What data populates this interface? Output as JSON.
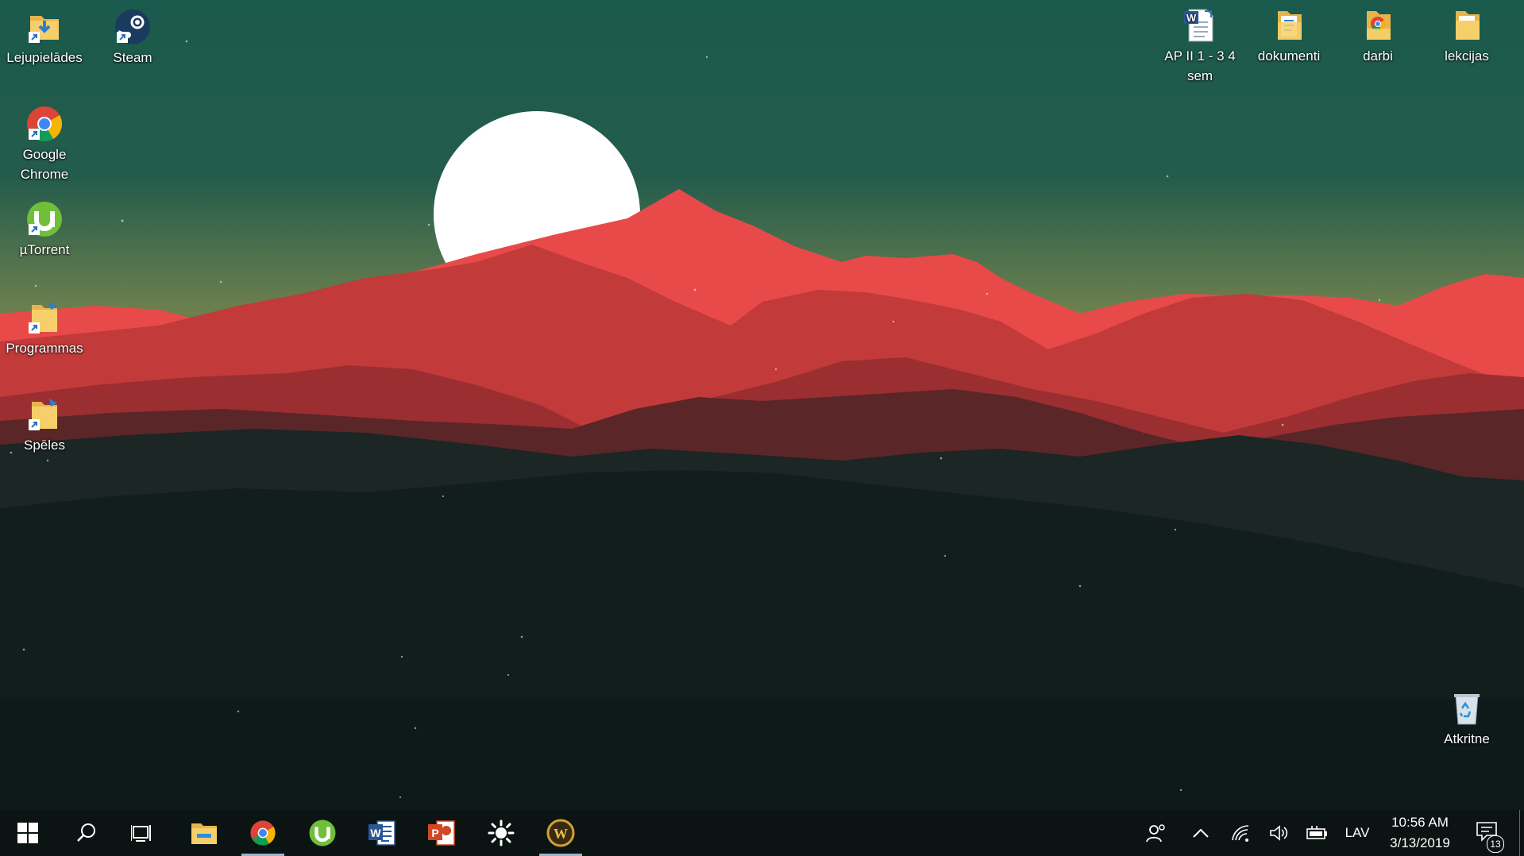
{
  "desktop": {
    "left_icons": [
      {
        "name": "Lejupielādes",
        "icon": "downloads-folder-icon"
      },
      {
        "name": "Steam",
        "icon": "steam-icon"
      },
      {
        "name": "Google Chrome",
        "icon": "chrome-icon"
      },
      {
        "name": "µTorrent",
        "icon": "utorrent-icon"
      },
      {
        "name": "Programmas",
        "icon": "folder-shortcut-icon"
      },
      {
        "name": "Spēles",
        "icon": "folder-shortcut-icon"
      }
    ],
    "right_icons": [
      {
        "name": "AP II 1 - 3  4 sem",
        "icon": "word-document-icon"
      },
      {
        "name": "dokumenti",
        "icon": "folder-icon"
      },
      {
        "name": "darbi",
        "icon": "folder-chrome-icon"
      },
      {
        "name": "lekcijas",
        "icon": "folder-icon"
      }
    ],
    "recycle_bin": {
      "name": "Atkritne",
      "icon": "recycle-bin-icon"
    }
  },
  "taskbar": {
    "pinned": [
      {
        "icon": "windows-start-icon"
      },
      {
        "icon": "search-icon"
      },
      {
        "icon": "task-view-icon"
      },
      {
        "icon": "file-explorer-icon"
      },
      {
        "icon": "chrome-icon",
        "running": true
      },
      {
        "icon": "utorrent-icon"
      },
      {
        "icon": "word-icon"
      },
      {
        "icon": "powerpoint-icon"
      },
      {
        "icon": "brightness-icon"
      },
      {
        "icon": "world-of-warcraft-icon",
        "running": true
      }
    ],
    "tray": {
      "language": "LAV",
      "time": "10:56 AM",
      "date": "3/13/2019",
      "notification_count": "13"
    }
  },
  "colors": {
    "sky_top": "#1a5a4c",
    "sky_horizon": "#6b7f4e",
    "mountain_light": "#e84a4a",
    "mountain_mid": "#c23a3a",
    "mountain_dark": "#6a2a2a",
    "foreground": "#0f1c1a",
    "sun": "#ffffff",
    "taskbar": "#0b1413"
  }
}
